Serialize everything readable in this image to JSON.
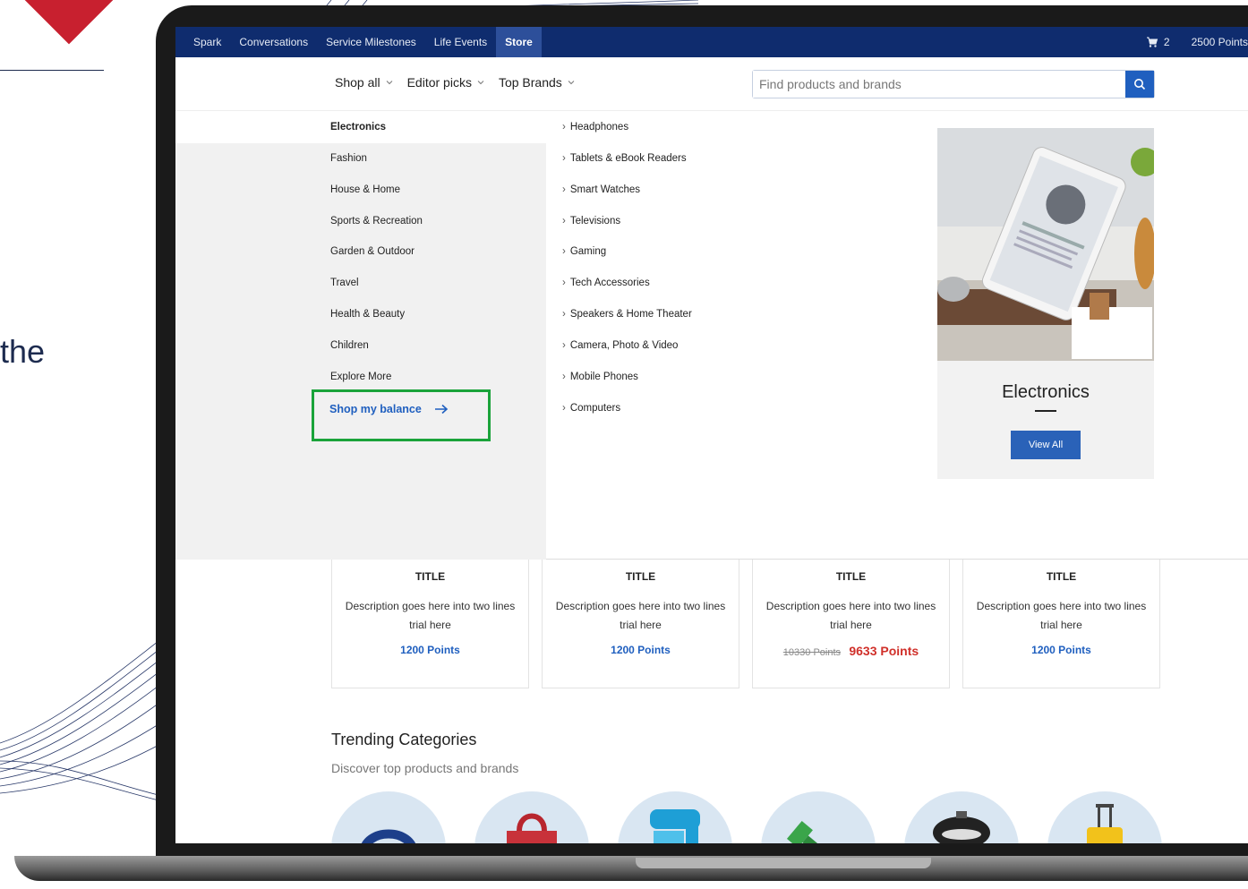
{
  "side": {
    "partial_text": "the"
  },
  "topnav": {
    "items": [
      {
        "label": "Spark",
        "active": false
      },
      {
        "label": "Conversations",
        "active": false
      },
      {
        "label": "Service Milestones",
        "active": false
      },
      {
        "label": "Life Events",
        "active": false
      },
      {
        "label": "Store",
        "active": true
      }
    ],
    "cart_count": "2",
    "points": "2500 Points"
  },
  "menu": {
    "shop_all": "Shop all",
    "editor_picks": "Editor picks",
    "top_brands": "Top Brands"
  },
  "search": {
    "placeholder": "Find products and brands",
    "value": ""
  },
  "categories": [
    "Electronics",
    "Fashion",
    "House & Home",
    "Sports & Recreation",
    "Garden & Outdoor",
    "Travel",
    "Health & Beauty",
    "Children",
    "Explore More"
  ],
  "active_category": "Electronics",
  "shop_balance": "Shop my balance",
  "subcategories": [
    "Headphones",
    "Tablets & eBook Readers",
    "Smart Watches",
    "Televisions",
    "Gaming",
    "Tech Accessories",
    "Speakers & Home Theater",
    "Camera, Photo & Video",
    "Mobile Phones",
    "Computers"
  ],
  "promo": {
    "title": "Electronics",
    "button": "View All"
  },
  "products": [
    {
      "title": "TITLE",
      "desc": "Description goes here into two lines trial here",
      "points": "1200 Points"
    },
    {
      "title": "TITLE",
      "desc": "Description goes here into two lines trial here",
      "points": "1200 Points"
    },
    {
      "title": "TITLE",
      "desc": "Description goes here into two lines trial here",
      "old_points": "10330 Points",
      "sale_points": "9633 Points"
    },
    {
      "title": "TITLE",
      "desc": "Description goes here into two lines trial here",
      "points": "1200 Points"
    }
  ],
  "trending": {
    "title": "Trending Categories",
    "subtitle": "Discover top products and brands"
  },
  "colors": {
    "nav_bg": "#0f2c6e",
    "accent_blue": "#1f5fbf",
    "highlight_green": "#1aa33a",
    "sale_red": "#d0302a",
    "brand_red": "#c8202f"
  }
}
